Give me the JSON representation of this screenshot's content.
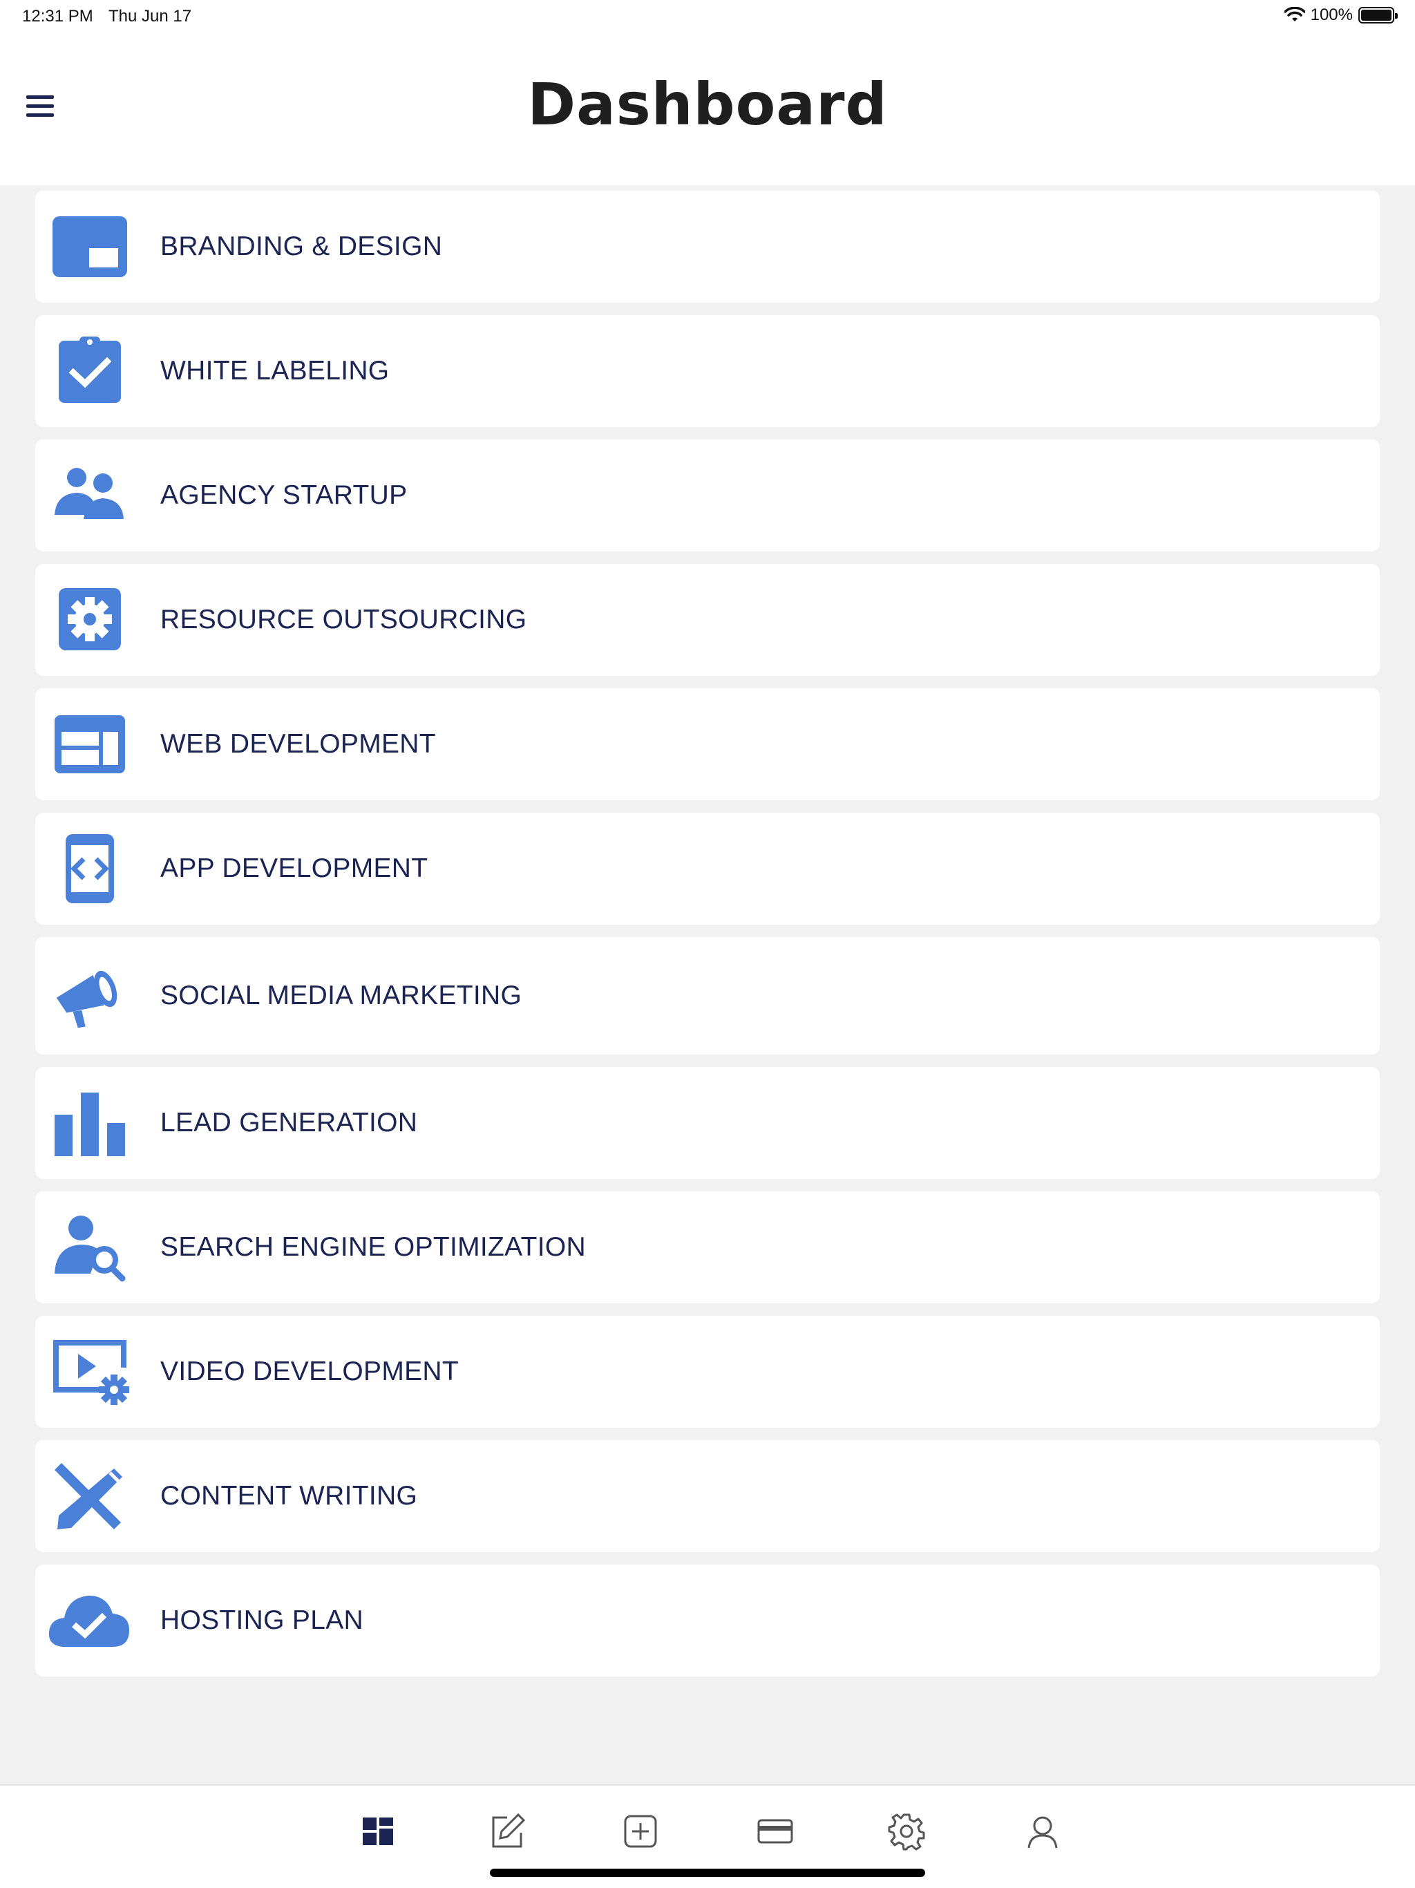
{
  "status_bar": {
    "time": "12:31 PM",
    "date": "Thu Jun 17",
    "battery": "100%"
  },
  "header": {
    "title": "Dashboard",
    "menu_icon": "hamburger-icon"
  },
  "colors": {
    "accent": "#4a80d8",
    "text": "#1b2452",
    "background": "#f1f1f2"
  },
  "services": [
    {
      "label": "BRANDING & DESIGN",
      "icon": "branding-icon"
    },
    {
      "label": "WHITE LABELING",
      "icon": "clipboard-check-icon"
    },
    {
      "label": "AGENCY STARTUP",
      "icon": "users-icon"
    },
    {
      "label": "RESOURCE OUTSOURCING",
      "icon": "gear-box-icon"
    },
    {
      "label": "WEB DEVELOPMENT",
      "icon": "web-layout-icon"
    },
    {
      "label": "APP DEVELOPMENT",
      "icon": "mobile-code-icon"
    },
    {
      "label": "SOCIAL MEDIA MARKETING",
      "icon": "megaphone-icon"
    },
    {
      "label": "LEAD GENERATION",
      "icon": "bar-chart-icon"
    },
    {
      "label": "SEARCH ENGINE OPTIMIZATION",
      "icon": "user-search-icon"
    },
    {
      "label": "VIDEO DEVELOPMENT",
      "icon": "video-settings-icon"
    },
    {
      "label": "CONTENT WRITING",
      "icon": "pencil-ruler-icon"
    },
    {
      "label": "HOSTING PLAN",
      "icon": "cloud-check-icon"
    }
  ],
  "tabs": [
    {
      "name": "dashboard",
      "icon": "dashboard-icon",
      "active": true
    },
    {
      "name": "edit",
      "icon": "edit-icon",
      "active": false
    },
    {
      "name": "add",
      "icon": "add-square-icon",
      "active": false
    },
    {
      "name": "payment",
      "icon": "credit-card-icon",
      "active": false
    },
    {
      "name": "settings",
      "icon": "settings-icon",
      "active": false
    },
    {
      "name": "profile",
      "icon": "profile-icon",
      "active": false
    }
  ]
}
